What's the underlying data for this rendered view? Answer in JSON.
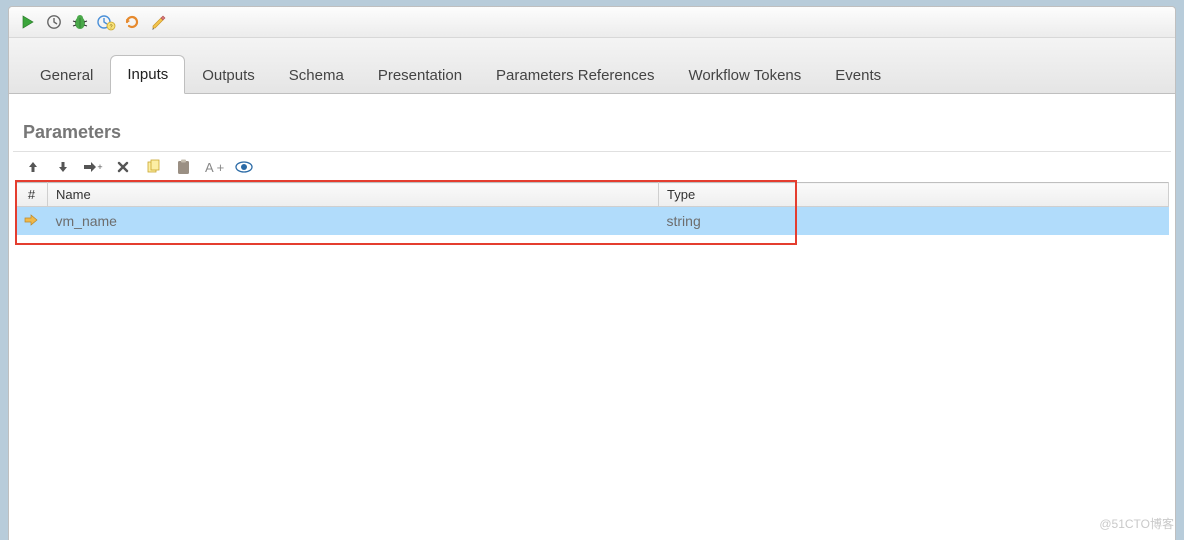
{
  "toolbar": {
    "run": "Run",
    "schedule": "Schedule",
    "debug": "Debug",
    "timer": "Timer",
    "refresh": "Refresh",
    "edit": "Edit"
  },
  "tabs": {
    "general": "General",
    "inputs": "Inputs",
    "outputs": "Outputs",
    "schema": "Schema",
    "presentation": "Presentation",
    "param_refs": "Parameters References",
    "workflow_tokens": "Workflow Tokens",
    "events": "Events"
  },
  "section": {
    "title": "Parameters"
  },
  "param_toolbar": {
    "up": "Move Up",
    "down": "Move Down",
    "add": "Add",
    "delete": "Delete",
    "copy": "Copy",
    "paste": "Paste",
    "a_plus": "A +",
    "eye": "Show/Hide"
  },
  "grid": {
    "headers": {
      "num": "#",
      "name": "Name",
      "type": "Type"
    },
    "rows": [
      {
        "name": "vm_name",
        "type": "string"
      }
    ]
  },
  "watermark": "@51CTO博客"
}
